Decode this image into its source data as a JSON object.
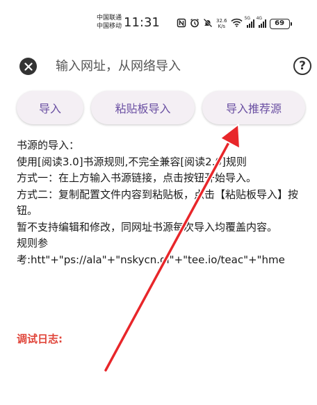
{
  "status_bar": {
    "carrier_1": "中国联通",
    "carrier_2": "中国移动",
    "time": "11:31",
    "net_speed_value": "32.6",
    "net_speed_unit": "K/s",
    "signal_1_label": "5G",
    "signal_2_label": "4G",
    "battery_level": "69"
  },
  "top_bar": {
    "url_placeholder": "输入网址，从网络导入"
  },
  "buttons": {
    "import": "导入",
    "clipboard_import": "粘贴板导入",
    "recommended_import": "导入推荐源"
  },
  "description": {
    "lines": [
      "书源的导入：",
      "使用[阅读3.0]书源规则,不完全兼容[阅读2.0]规则",
      "方式一：在上方输入书源链接，点击按钮开始导入。",
      "方式二：复制配置文件内容到粘贴板，点击【粘贴板导入】按钮。",
      "暂不支持编辑和修改，同网址书源每次导入均覆盖内容。",
      "规则参考:htt\"+\"ps://ala\"+\"nskycn.gi\"+\"tee.io/teac\"+\"hme"
    ]
  },
  "debug": {
    "title": "调试日志:"
  },
  "colors": {
    "accent_text": "#6a4fa2",
    "button_bg": "#f4eff4",
    "debug_title": "#e0453a",
    "annotation_arrow": "#e8262a"
  }
}
